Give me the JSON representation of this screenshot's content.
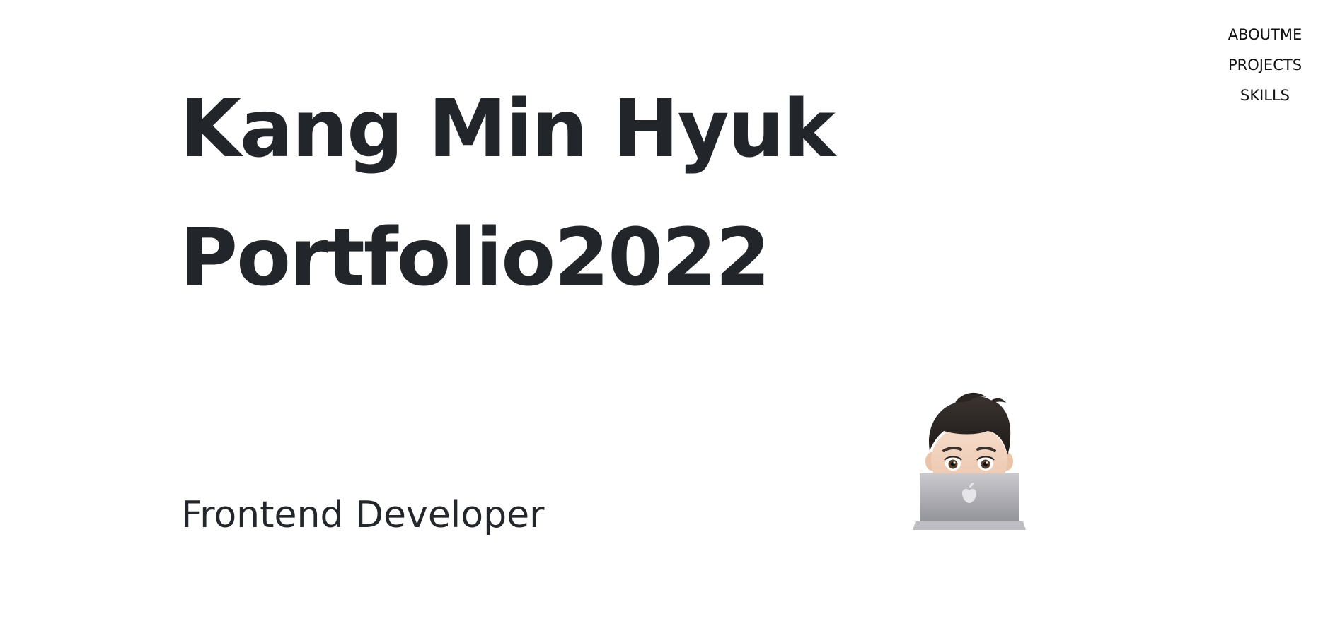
{
  "nav": {
    "items": [
      {
        "label": "ABOUTME"
      },
      {
        "label": "PROJECTS"
      },
      {
        "label": "SKILLS"
      }
    ]
  },
  "hero": {
    "title_line1": "Kang Min Hyuk",
    "title_line2": "Portfolio2022",
    "subtitle": "Frontend Developer"
  },
  "avatar": {
    "icon": "memoji-developer-laptop-icon"
  },
  "colors": {
    "background": "#ffffff",
    "text": "#22262b",
    "nav_text": "#111111"
  }
}
